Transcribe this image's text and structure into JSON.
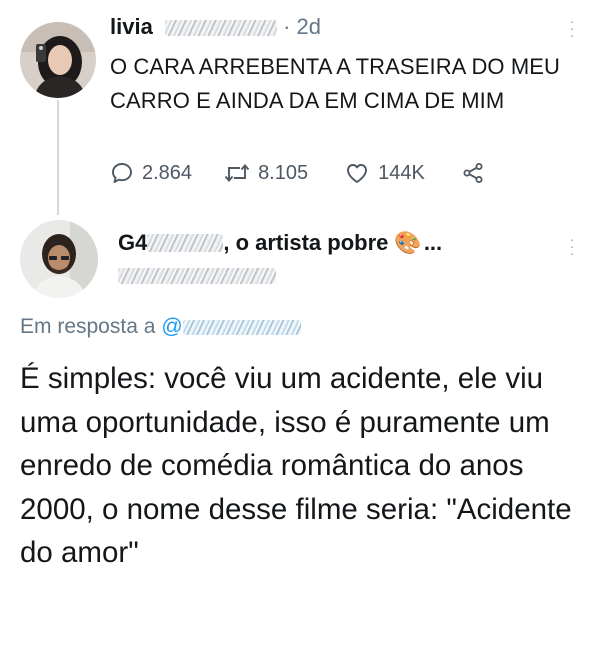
{
  "tweet1": {
    "display_name": "livia",
    "handle": "@livia",
    "separator": "·",
    "time": "2d",
    "text": "O CARA ARREBENTA A TRASEIRA DO MEU CARRO E AINDA DA EM CIMA DE MIM",
    "stats": {
      "replies": "2.864",
      "retweets": "8.105",
      "likes": "144K"
    },
    "icons": [
      "reply-icon",
      "retweet-icon",
      "like-icon",
      "share-icon",
      "more-icon"
    ]
  },
  "tweet2": {
    "display_name_prefix": "G4",
    "display_name_suffix": ", o artista pobre",
    "emoji": "🎨",
    "ellipsis": "...",
    "reply_to_label": "Em resposta a",
    "reply_to_at": "@",
    "text": "É simples: você viu um acidente, ele viu uma oportunidade, isso é puramente um enredo de comédia romântica do anos 2000, o nome desse filme seria: \"Acidente do amor\""
  },
  "colors": {
    "text": "#14171a",
    "muted": "#657786",
    "link": "#1d9bf0",
    "thread_line": "#cfd9de"
  }
}
